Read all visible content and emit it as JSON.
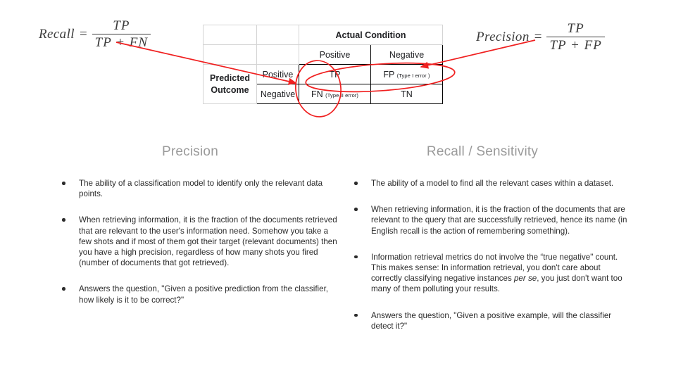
{
  "formulas": {
    "recall": {
      "name": "Recall",
      "equals": "=",
      "numerator": "TP",
      "denominator": "TP + FN"
    },
    "precision": {
      "name": "Precision",
      "equals": "=",
      "numerator": "TP",
      "denominator": "TP + FP"
    }
  },
  "matrix": {
    "actual_condition_header": "Actual Condition",
    "actual_positive": "Positive",
    "actual_negative": "Negative",
    "predicted_outcome_label_line1": "Predicted",
    "predicted_outcome_label_line2": "Outcome",
    "predicted_positive": "Positive",
    "predicted_negative": "Negative",
    "cell_tp": "TP",
    "cell_fp": "FP",
    "cell_fp_note": "(Type I error )",
    "cell_fn": "FN",
    "cell_fn_note": "(Type II error)",
    "cell_tn": "TN"
  },
  "annotation_color": "#f02020",
  "columns": {
    "precision": {
      "heading": "Precision",
      "bullets": [
        "The ability of a classification model to identify only the relevant data points.",
        "When retrieving information, it is the fraction of the documents retrieved that are relevant to the user's information need. Somehow you take a few shots and if most of them got their target (relevant documents) then you have a high precision, regardless of how many shots you fired (number of documents that got retrieved).",
        "Answers the question, \"Given a positive prediction from the classifier, how likely is it to be correct?\""
      ]
    },
    "recall": {
      "heading": "Recall / Sensitivity",
      "bullets": [
        "The ability of a model to find all the relevant cases within a dataset.",
        "When retrieving information, it is the fraction of the documents that are relevant to the query that are successfully retrieved, hence its name (in English recall is the action of remembering something).",
        {
          "part1": "Information retrieval metrics do not involve the “true negative\" count. This makes sense: In information retrieval, you don't care about correctly classifying negative instances ",
          "italic": "per se",
          "part2": ", you just don't want too many of them polluting your results."
        },
        "Answers the question, \"Given a positive example, will the classifier detect it?\""
      ]
    }
  }
}
